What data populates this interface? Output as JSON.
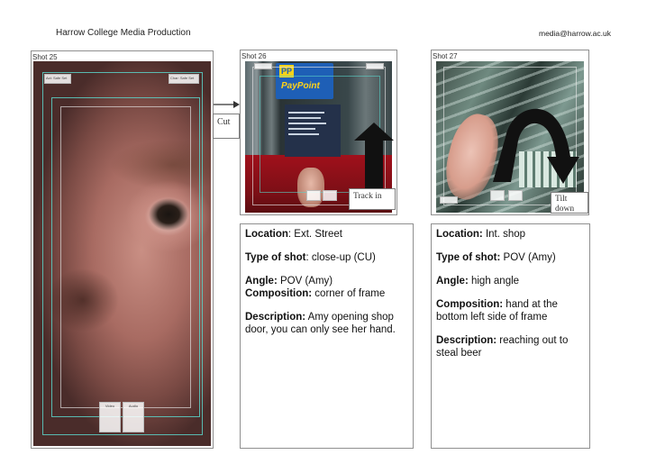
{
  "header": {
    "title": "Harrow College Media Production",
    "email": "media@harrow.ac.uk"
  },
  "shots": [
    {
      "label": "Shot 25",
      "safe_left": "Act: Safe Set",
      "safe_right": "Char: Safe Set",
      "bottom_a": "Video",
      "bottom_b": "Audio"
    },
    {
      "label": "Shot 26",
      "overlay_label": "Track in",
      "sign": "PayPoint",
      "sign_small": "PP"
    },
    {
      "label": "Shot 27",
      "overlay_label": "Tilt down"
    }
  ],
  "transition": {
    "label": "Cut"
  },
  "descriptions": {
    "shot26": {
      "location_label": "Location",
      "location_value": ": Ext. Street",
      "type_label": "Type of shot",
      "type_value": ": close-up (CU)",
      "angle_label": "Angle:",
      "angle_value": " POV (Amy)",
      "composition_label": "Composition:",
      "composition_value": " corner of frame",
      "description_label": "Description:",
      "description_value": " Amy opening shop door, you can only see her hand."
    },
    "shot27": {
      "location_label": "Location:",
      "location_value": " Int. shop",
      "type_label": "Type of shot:",
      "type_value": " POV (Amy)",
      "angle_label": "Angle:",
      "angle_value": " high angle",
      "composition_label": "Composition:",
      "composition_value": " hand at the bottom left side of frame",
      "description_label": "Description:",
      "description_value": " reaching out to steal beer"
    }
  },
  "colors": {
    "guide": "#5ad2c8",
    "panel_border": "#8f8f8f"
  }
}
